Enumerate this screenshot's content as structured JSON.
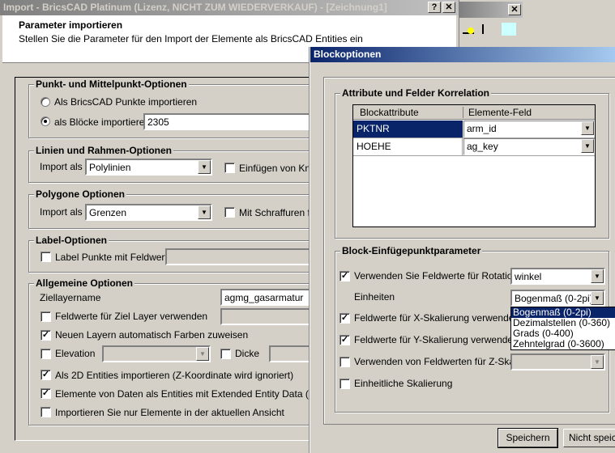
{
  "main_window": {
    "title": "Import  - BricsCAD Platinum (Lizenz, NICHT ZUM WIEDERVERKAUF) - [Zeichnung1]",
    "help": "?",
    "close": "✕",
    "header_title": "Parameter importieren",
    "header_subtitle": "Stellen Sie die Parameter für den Import der Elemente als BricsCAD Entities ein",
    "punkt": {
      "label": "Punkt- und Mittelpunkt-Optionen",
      "opt1": "Als BricsCAD Punkte importieren",
      "opt2": "als Blöcke importieren",
      "block_value": "2305",
      "selected": "opt2"
    },
    "linien": {
      "label": "Linien und Rahmen-Optionen",
      "import_label": "Import als",
      "import_value": "Polylinien",
      "check_label": "Einfügen von Kno",
      "checked": false
    },
    "polygone": {
      "label": "Polygone Optionen",
      "import_label": "Import als",
      "import_value": "Grenzen",
      "check_label": "Mit Schraffuren fü",
      "checked": false
    },
    "labelopt": {
      "label": "Label-Optionen",
      "check_label": "Label Punkte mit Feldwert",
      "checked": false
    },
    "allgemein": {
      "label": "Allgemeine Optionen",
      "ziel_label": "Ziellayername",
      "ziel_value": "agmg_gasarmatur",
      "feldwerte": "Feldwerte für Ziel Layer verwenden",
      "farben": "Neuen Layern automatisch Farben zuweisen",
      "elevation": "Elevation",
      "dicke": "Dicke",
      "als2d": "Als 2D Entities importieren (Z-Koordinate wird ignoriert)",
      "eed": "Elemente von Daten als Entities mit Extended Entity Data (EED)",
      "ansicht": "Importieren Sie nur Elemente in der aktuellen Ansicht"
    }
  },
  "block_dialog": {
    "title": "Blockoptionen",
    "korrelation": {
      "label": "Attribute und Felder Korrelation",
      "columns": [
        "Blockattribute",
        "Elemente-Feld"
      ],
      "rows": [
        {
          "attr": "PKTNR",
          "field": "arm_id"
        },
        {
          "attr": "HOEHE",
          "field": "ag_key"
        }
      ]
    },
    "einfuege": {
      "label": "Block-Einfügepunktparameter",
      "rotation": "Verwenden Sie Feldwerte für Rotation",
      "rotation_value": "winkel",
      "einheiten": "Einheiten",
      "einheiten_value": "Bogenmaß (0-2pi)",
      "einheiten_options": [
        "Bogenmaß (0-2pi)",
        "Dezimalstellen (0-360)",
        "Grads (0-400)",
        "Zehntelgrad (0-3600)"
      ],
      "xskal": "Feldwerte für X-Skalierung verwenden",
      "yskal": "Feldwerte für Y-Skalierung verwenden",
      "zskal": "Verwenden von Feldwerten für Z-Skala",
      "einheitlich": "Einheitliche Skalierung"
    },
    "save": "Speichern",
    "nosave": "Nicht speich"
  },
  "bg_window": {
    "close": "✕"
  },
  "colors": {
    "active_title": "#0a246a",
    "selection": "#0a246a",
    "face": "#d4d0c8"
  }
}
